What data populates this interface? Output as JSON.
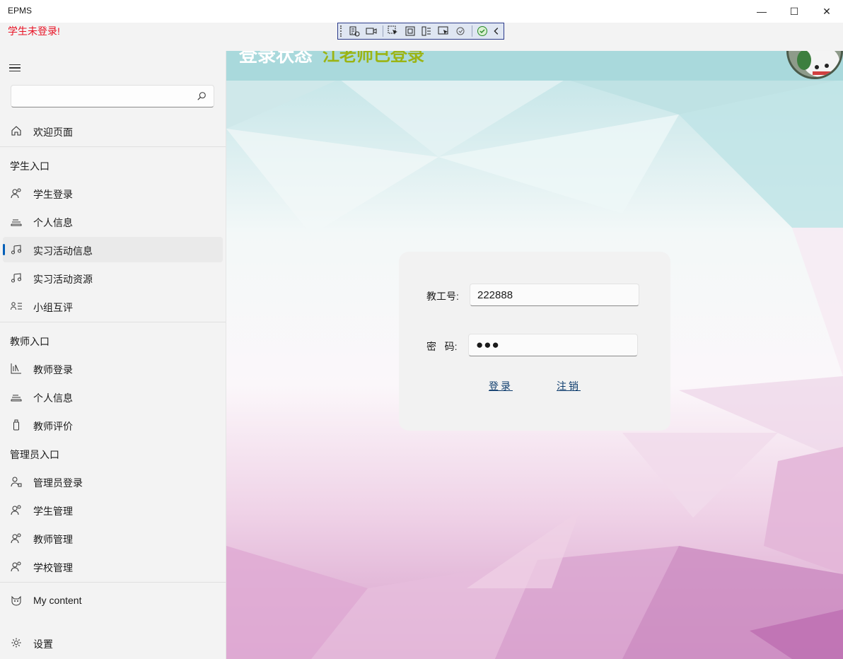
{
  "window": {
    "title": "EPMS",
    "minimize_glyph": "—",
    "maximize_glyph": "☐",
    "close_glyph": "✕"
  },
  "status": {
    "student_login_status": "学生未登录!"
  },
  "sidebar": {
    "search": {
      "value": "",
      "placeholder": ""
    },
    "home": {
      "label": "欢迎页面",
      "icon": "home-icon"
    },
    "sections": [
      {
        "title": "学生入口",
        "items": [
          {
            "label": "学生登录",
            "icon": "people-icon"
          },
          {
            "label": "个人信息",
            "icon": "tray-icon"
          },
          {
            "label": "实习活动信息",
            "icon": "music-note-icon",
            "selected": true
          },
          {
            "label": "实习活动资源",
            "icon": "music-note-icon"
          },
          {
            "label": "小组互评",
            "icon": "person-list-icon"
          }
        ]
      },
      {
        "title": "教师入口",
        "items": [
          {
            "label": "教师登录",
            "icon": "stats-icon"
          },
          {
            "label": "个人信息",
            "icon": "tray-icon"
          },
          {
            "label": "教师评价",
            "icon": "usb-drive-icon"
          }
        ]
      },
      {
        "title": "管理员入口",
        "items": [
          {
            "label": "管理员登录",
            "icon": "person-key-icon"
          },
          {
            "label": "学生管理",
            "icon": "people-icon"
          },
          {
            "label": "教师管理",
            "icon": "people-icon"
          },
          {
            "label": "学校管理",
            "icon": "people-icon"
          }
        ]
      }
    ],
    "footer": [
      {
        "label": "My content",
        "icon": "cat-face-icon"
      },
      {
        "label": "设置",
        "icon": "gear-icon"
      }
    ]
  },
  "banner": {
    "status_label": "登录状态",
    "status_value": "江老师已登录"
  },
  "login_form": {
    "id_label": "教工号:",
    "id_value": "222888",
    "password_label": "密   码:",
    "password_value": "●●●",
    "login_button": "登录",
    "logout_button": "注销"
  },
  "colors": {
    "accent": "#005fb8",
    "status_error": "#e81123",
    "banner_value": "#9bb414",
    "link": "#0f3d6e"
  }
}
